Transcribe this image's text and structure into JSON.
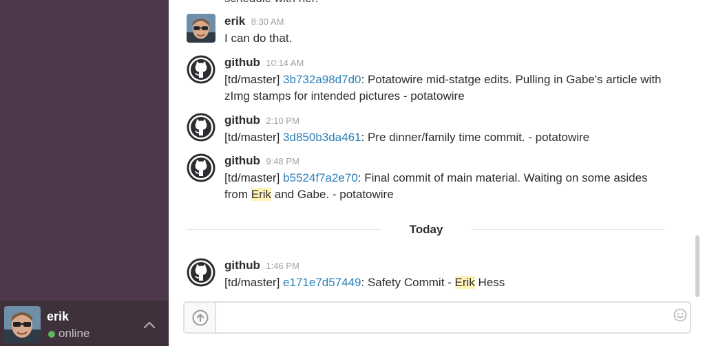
{
  "sidebar": {
    "user": {
      "name": "erik",
      "status": "online"
    }
  },
  "messages": {
    "cut_off_text": "schedule with her.",
    "items": [
      {
        "author": "erik",
        "time": "8:30 AM",
        "text": "I can do that."
      },
      {
        "author": "github",
        "time": "10:14 AM",
        "prefix": "[td/master]",
        "commit": "3b732a98d7d0",
        "text": ": Potatowire mid-statge edits. Pulling in Gabe's article with zImg stamps for intended pictures - potatowire"
      },
      {
        "author": "github",
        "time": "2:10 PM",
        "prefix": "[td/master]",
        "commit": "3d850b3da461",
        "text": ": Pre dinner/family time commit. - potatowire"
      },
      {
        "author": "github",
        "time": "9:48 PM",
        "prefix": "[td/master]",
        "commit": "b5524f7a2e70",
        "text_before_mention": ": Final commit of main material. Waiting on some asides from ",
        "mention": "Erik",
        "text_after_mention": " and Gabe. - potatowire"
      },
      {
        "author": "github",
        "time": "1:46 PM",
        "prefix": "[td/master]",
        "commit": "e171e7d57449",
        "text_before_mention": ": Safety Commit - ",
        "mention": "Erik",
        "text_after_mention": " Hess"
      }
    ],
    "day_divider": "Today"
  },
  "composer": {
    "value": "",
    "upload_icon": "arrow-up-circle-icon",
    "emoji_icon": "smiley-icon"
  },
  "icons": {
    "github_avatar": "github-octocat-icon",
    "menu_toggle": "chevron-up-icon"
  },
  "colors": {
    "sidebar_bg": "#4d394b",
    "user_panel_bg": "#3e313c",
    "link": "#2a80b9",
    "mention_highlight": "#fff3b8",
    "presence_online": "#5cb85c"
  }
}
